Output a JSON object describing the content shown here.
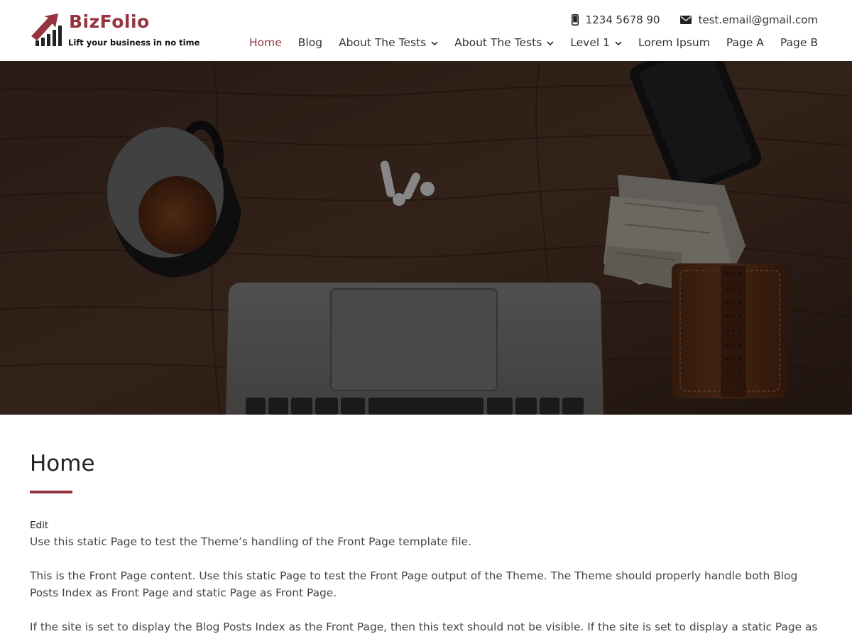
{
  "brand": {
    "name": "BizFolio",
    "tagline": "Lift your business in no time",
    "accent_color": "#96343f"
  },
  "contact": {
    "phone": {
      "icon": "mobile-phone-icon",
      "text": "1234 5678 90"
    },
    "email": {
      "icon": "envelope-icon",
      "text": "test.email@gmail.com"
    }
  },
  "nav": {
    "items": [
      {
        "label": "Home",
        "active": true,
        "has_dropdown": false
      },
      {
        "label": "Blog",
        "active": false,
        "has_dropdown": false
      },
      {
        "label": "About The Tests",
        "active": false,
        "has_dropdown": true
      },
      {
        "label": "About The Tests",
        "active": false,
        "has_dropdown": true
      },
      {
        "label": "Level 1",
        "active": false,
        "has_dropdown": true
      },
      {
        "label": "Lorem Ipsum",
        "active": false,
        "has_dropdown": false
      },
      {
        "label": "Page A",
        "active": false,
        "has_dropdown": false
      },
      {
        "label": "Page B",
        "active": false,
        "has_dropdown": false
      }
    ]
  },
  "hero": {
    "image": "desk-with-coffee-laptop-earbuds-phone-cash-wallet"
  },
  "page": {
    "title": "Home",
    "edit_label": "Edit",
    "paragraphs": [
      "Use this static Page to test the Theme’s handling of the Front Page template file.",
      "This is the Front Page content. Use this static Page to test the Front Page output of the Theme. The Theme should properly handle both Blog Posts Index as Front Page and static Page as Front Page.",
      "If the site is set to display the Blog Posts Index as the Front Page, then this text should not be visible. If the site is set to display a static Page as the"
    ]
  }
}
